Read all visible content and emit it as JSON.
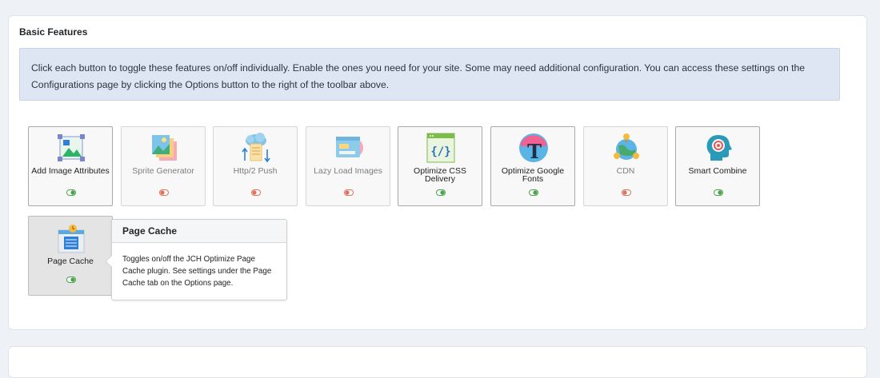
{
  "section": {
    "title": "Basic Features",
    "info": "Click each button to toggle these features on/off individually. Enable the ones you need for your site. Some may need additional configuration. You can access these settings on the Configurations page by clicking the Options button to the right of the toolbar above."
  },
  "colors": {
    "toggle_on": "#47a447",
    "toggle_off": "#e0715a"
  },
  "features": [
    {
      "label": "Add Image Attributes",
      "icon": "image-attributes-icon",
      "enabled": true
    },
    {
      "label": "Sprite Generator",
      "icon": "sprite-generator-icon",
      "enabled": false
    },
    {
      "label": "Http/2 Push",
      "icon": "cloud-push-icon",
      "enabled": false
    },
    {
      "label": "Lazy Load Images",
      "icon": "lazy-load-icon",
      "enabled": false
    },
    {
      "label": "Optimize CSS Delivery",
      "icon": "css-code-icon",
      "enabled": true
    },
    {
      "label": "Optimize Google Fonts",
      "icon": "font-t-icon",
      "enabled": true
    },
    {
      "label": "CDN",
      "icon": "cdn-globe-icon",
      "enabled": false
    },
    {
      "label": "Smart Combine",
      "icon": "smart-head-icon",
      "enabled": true
    },
    {
      "label": "Page Cache",
      "icon": "page-cache-icon",
      "enabled": true
    }
  ],
  "tooltip": {
    "title": "Page Cache",
    "body": "Toggles on/off the JCH Optimize Page Cache plugin. See settings under the Page Cache tab on the Options page."
  }
}
